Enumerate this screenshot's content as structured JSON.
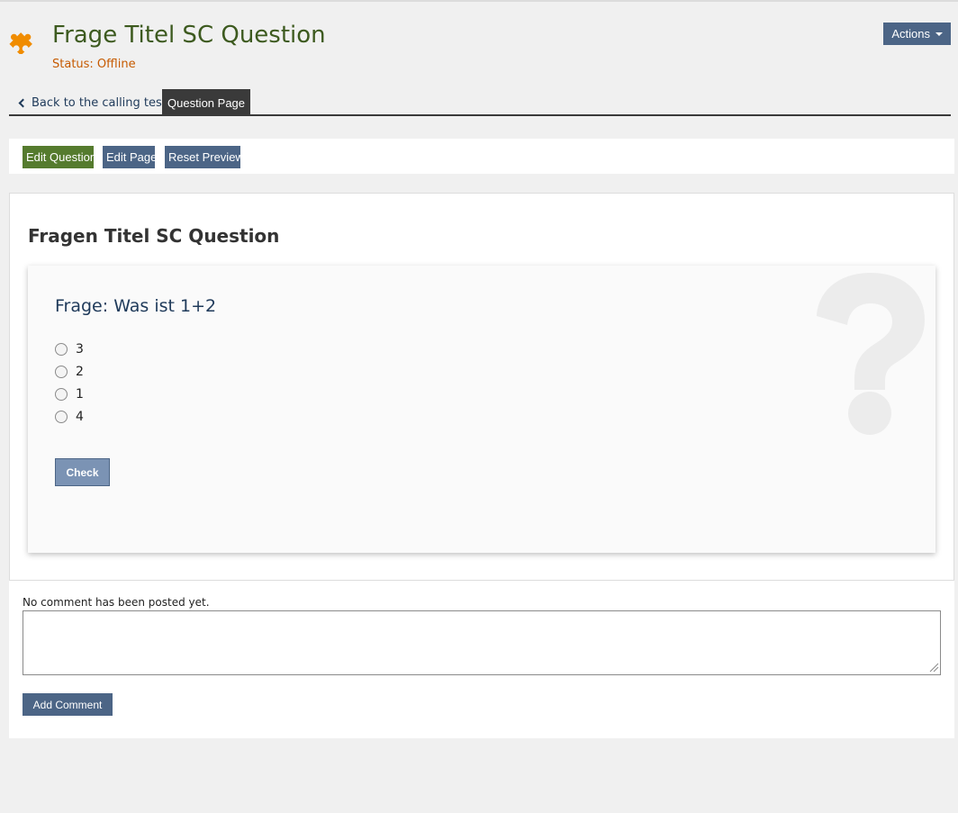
{
  "header": {
    "title": "Frage Titel SC Question",
    "status": "Status: Offline",
    "actions_label": "Actions",
    "icon": "puzzle-icon",
    "accent_color": "#f08c00"
  },
  "tabs": {
    "back_label": "Back to the calling test",
    "active_label": "Question Page"
  },
  "toolbar": {
    "edit_question_label": "Edit Question",
    "edit_page_label": "Edit Page",
    "reset_preview_label": "Reset Preview"
  },
  "question": {
    "title": "Fragen Titel SC Question",
    "text": "Frage: Was ist 1+2",
    "options": [
      {
        "label": "3"
      },
      {
        "label": "2"
      },
      {
        "label": "1"
      },
      {
        "label": "4"
      }
    ],
    "check_label": "Check"
  },
  "comments": {
    "empty_message": "No comment has been posted yet.",
    "input_value": "",
    "add_label": "Add Comment"
  },
  "colors": {
    "primary": "#4c6586",
    "success": "#557b2e",
    "title": "#3d5a1f",
    "status": "#c65a00"
  }
}
